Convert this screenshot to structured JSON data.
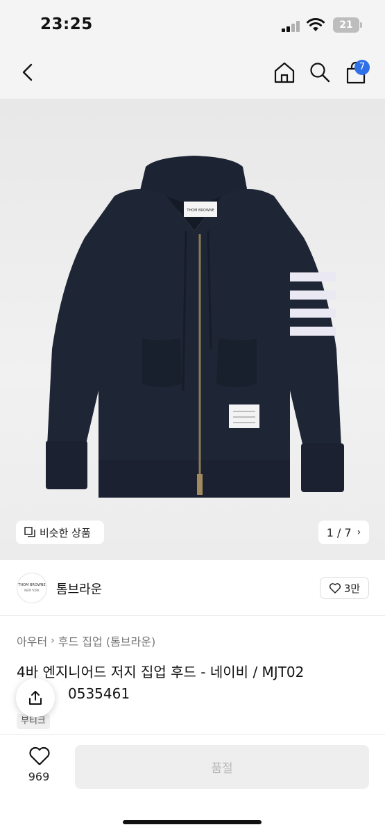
{
  "status_bar": {
    "time": "23:25",
    "battery": "21"
  },
  "nav": {
    "back_icon": "chevron-left-icon",
    "home_icon": "home-icon",
    "search_icon": "search-icon",
    "cart_icon": "shopping-bag-icon",
    "cart_count": "7"
  },
  "gallery": {
    "similar_label": "비슷한 상품",
    "pager": "1 / 7",
    "image_label": "THOM BROWNE"
  },
  "brand": {
    "logo_text_main": "THOM BROWNE",
    "logo_text_sub": "NEW YORK",
    "name": "톰브라운",
    "likes": "3만"
  },
  "product": {
    "breadcrumb": [
      "아우터",
      "후드 집업 (톰브라운)"
    ],
    "title_line1": "4바 엔지니어드 저지 집업 후드 - 네이비 / MJT02",
    "title_line2": "0535461",
    "tag": "부티크"
  },
  "bottom": {
    "wish_count": "969",
    "buy_label": "품절"
  },
  "colors": {
    "accent": "#2f6fe8",
    "jacket": "#1e2535",
    "stripe": "#e9e8f3"
  }
}
